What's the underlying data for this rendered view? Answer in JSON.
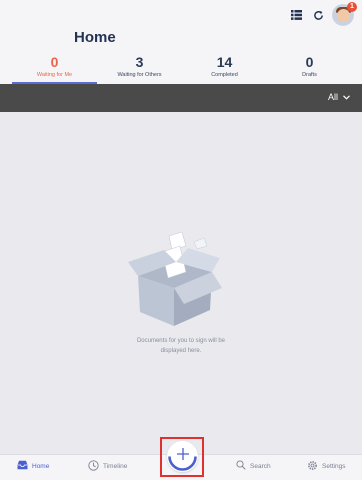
{
  "header": {
    "title": "Home",
    "notification_count": "1"
  },
  "tabs": [
    {
      "count": "0",
      "label": "Waiting for Me"
    },
    {
      "count": "3",
      "label": "Waiting for Others"
    },
    {
      "count": "14",
      "label": "Completed"
    },
    {
      "count": "0",
      "label": "Drafts"
    }
  ],
  "filter": {
    "selected": "All"
  },
  "empty_state": {
    "line1": "Documents for you to sign will be",
    "line2": "displayed here."
  },
  "bottom_nav": {
    "home": "Home",
    "timeline": "Timeline",
    "search": "Search",
    "settings": "Settings"
  },
  "colors": {
    "accent": "#5a6cd6",
    "active_tab": "#e8644a",
    "filter_bar": "#4a4a4a",
    "highlight_box": "#e03030"
  }
}
